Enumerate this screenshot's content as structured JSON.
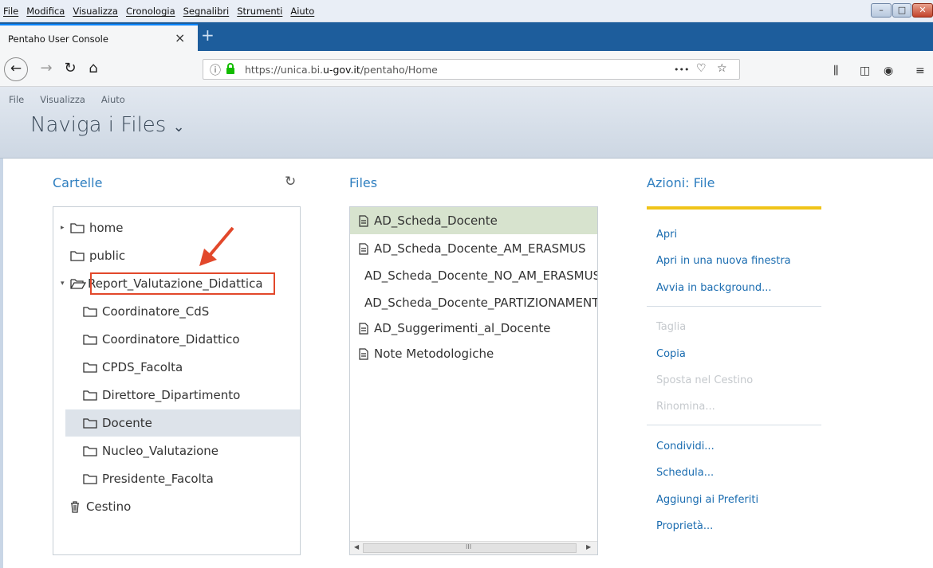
{
  "browser": {
    "menu": [
      "File",
      "Modifica",
      "Visualizza",
      "Cronologia",
      "Segnalibri",
      "Strumenti",
      "Aiuto"
    ],
    "tab_title": "Pentaho User Console",
    "url_prefix": "https://unica.bi.",
    "url_domain": "u-gov.it",
    "url_path": "/pentaho/Home",
    "url_more": "•••"
  },
  "app": {
    "menu": [
      "File",
      "Visualizza",
      "Aiuto"
    ],
    "title": "Naviga i Files",
    "title_chevron": "⌄"
  },
  "folders": {
    "heading": "Cartelle",
    "items": [
      {
        "label": "home",
        "expand": "▸"
      },
      {
        "label": "public",
        "expand": ""
      },
      {
        "label": "Report_Valutazione_Didattica",
        "expand": "▾"
      },
      {
        "label": "Coordinatore_CdS"
      },
      {
        "label": "Coordinatore_Didattico"
      },
      {
        "label": "CPDS_Facolta"
      },
      {
        "label": "Direttore_Dipartimento"
      },
      {
        "label": "Docente"
      },
      {
        "label": "Nucleo_Valutazione"
      },
      {
        "label": "Presidente_Facolta"
      },
      {
        "label": "Cestino"
      }
    ]
  },
  "files": {
    "heading": "Files",
    "items": [
      "AD_Scheda_Docente",
      "AD_Scheda_Docente_AM_ERASMUS",
      "AD_Scheda_Docente_NO_AM_ERASMUS",
      "AD_Scheda_Docente_PARTIZIONAMENTO",
      "AD_Suggerimenti_al_Docente",
      "Note Metodologiche"
    ],
    "scroll_grip": "III"
  },
  "actions": {
    "heading": "Azioni: File",
    "items": [
      "Apri",
      "Apri in una nuova finestra",
      "Avvia in background...",
      "Taglia",
      "Copia",
      "Sposta nel Cestino",
      "Rinomina...",
      "Condividi...",
      "Schedula...",
      "Aggiungi ai Preferiti",
      "Proprietà..."
    ]
  },
  "colors": {
    "accent": "#2f7fc0",
    "selected_file": "#d7e3ce",
    "yellow_bar": "#f0c419",
    "callout": "#e2482b"
  }
}
